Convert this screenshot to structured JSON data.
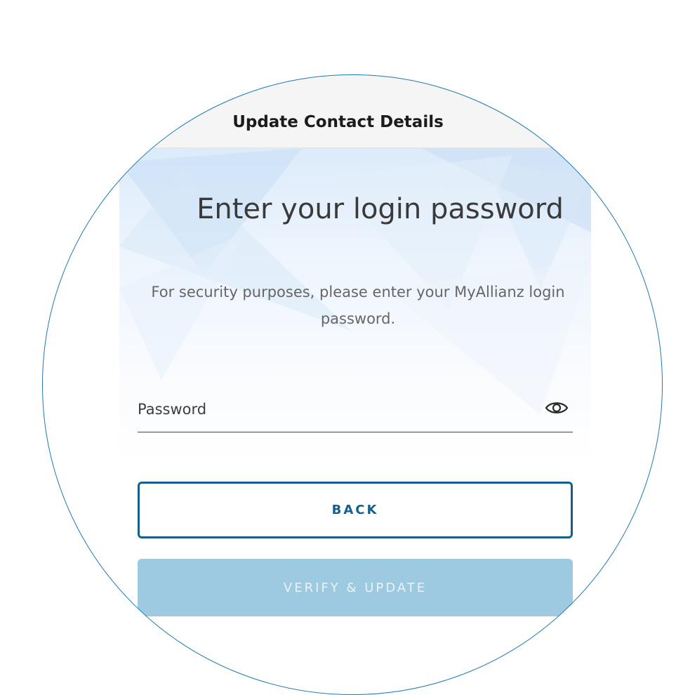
{
  "header": {
    "title": "Update Contact Details"
  },
  "main": {
    "heading": "Enter your login password",
    "description": "For security purposes, please enter your MyAllianz login password.",
    "password_field": {
      "label": "Password",
      "value": ""
    },
    "back_label": "BACK",
    "verify_label": "VERIFY & UPDATE"
  },
  "icons": {
    "password_toggle": "eye-icon"
  },
  "colors": {
    "primary": "#155f8e",
    "disabled_button": "#9ecae1",
    "disabled_button_text": "#e8f3f9",
    "outline": "#1d7ab3"
  }
}
